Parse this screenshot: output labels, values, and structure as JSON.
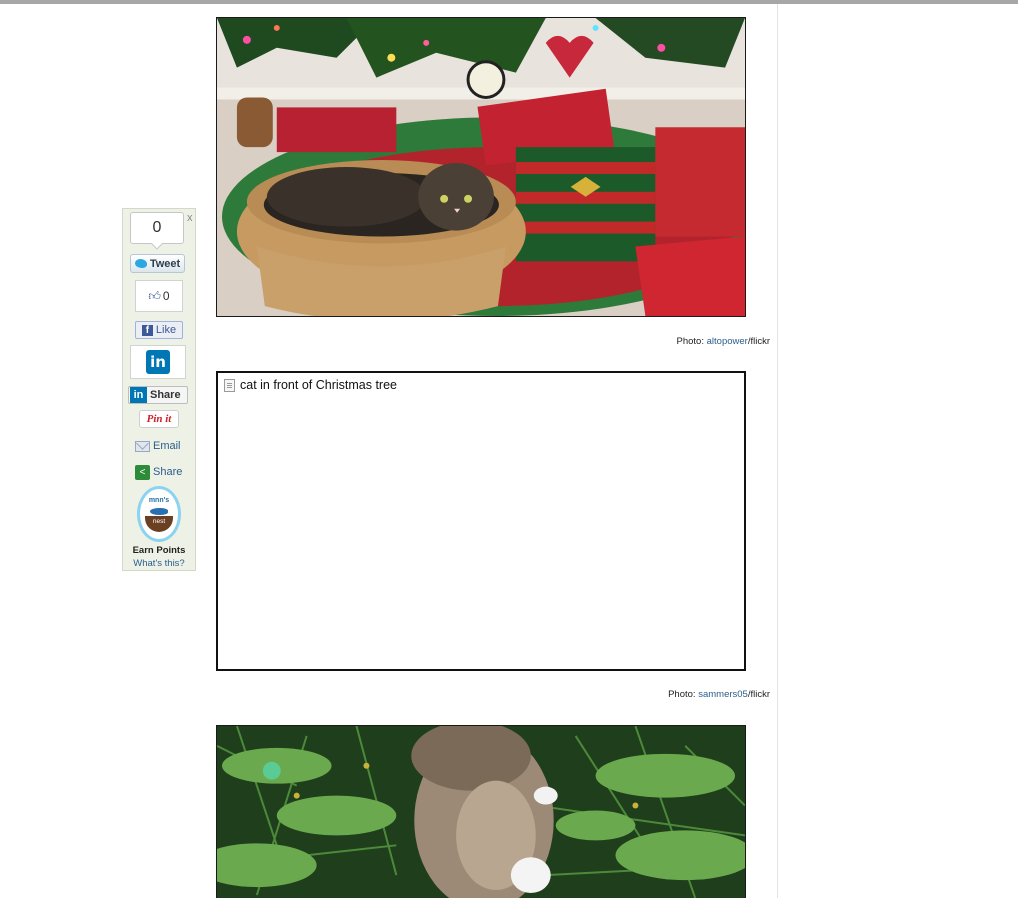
{
  "share_bar": {
    "close_label": "x",
    "tweet_count": "0",
    "tweet_label": "Tweet",
    "like_count": "0",
    "like_label": "Like",
    "linkedin_logo": "in",
    "linkedin_share_label": "Share",
    "pinit_label": "Pin it",
    "email_label": "Email",
    "share_label": "Share",
    "nest_top": "mnn's",
    "nest_bottom": "nest",
    "earn_points": "Earn Points",
    "whats_this": "What's this?",
    "icons": [
      "twitter-bird-icon",
      "thumbs-up-icon",
      "facebook-icon",
      "linkedin-icon",
      "envelope-icon",
      "share-icon"
    ]
  },
  "photos": [
    {
      "credit_prefix": "Photo: ",
      "credit_user": "altopower",
      "credit_suffix": "/flickr"
    },
    {
      "alt_text": "cat in front of Christmas tree",
      "credit_prefix": "Photo: ",
      "credit_user": "sammers05",
      "credit_suffix": "/flickr"
    }
  ],
  "colors": {
    "sidebar_bg": "#eef2e6",
    "link": "#2a5d8c",
    "linkedin": "#0077b5",
    "facebook": "#3b5998",
    "pinterest": "#cb2027"
  }
}
